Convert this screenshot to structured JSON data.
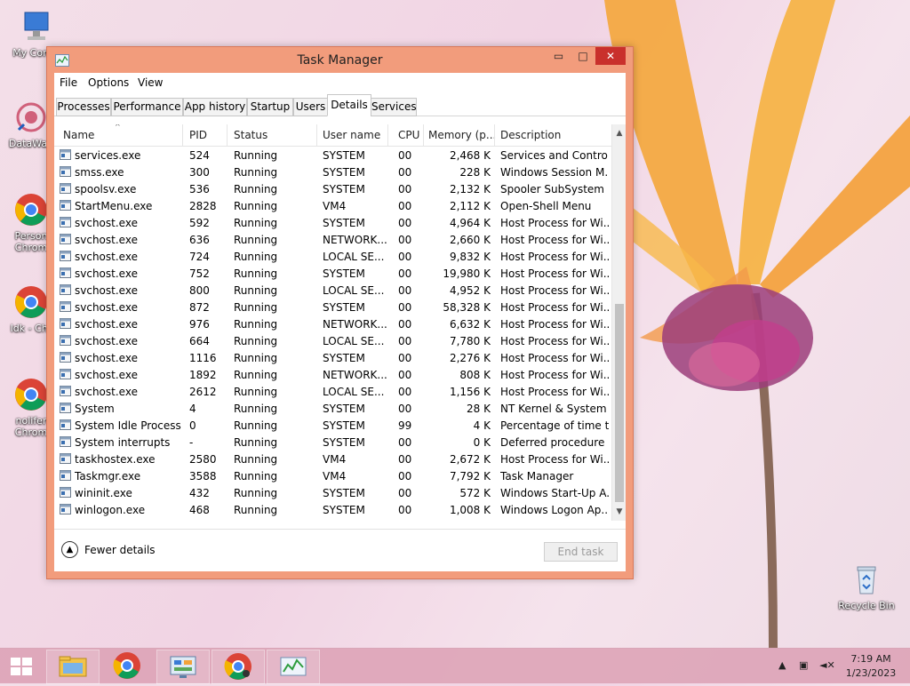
{
  "desktop": {
    "icons": [
      {
        "label": "My Comp",
        "glyph": "computer-icon"
      },
      {
        "label": "DataWag",
        "glyph": "app-icon"
      },
      {
        "label": "Person",
        "label2": "Chrom",
        "glyph": "chrome-icon"
      },
      {
        "label": "ldk - Chr",
        "glyph": "chrome-icon"
      },
      {
        "label": "nolifer",
        "label2": "Chrom",
        "glyph": "chrome-icon"
      },
      {
        "label": "Recycle Bin",
        "glyph": "recycle-bin-icon"
      }
    ]
  },
  "window": {
    "title": "Task Manager",
    "min_glyph": "▭",
    "max_glyph": "□",
    "close_glyph": "✕",
    "menu": [
      "File",
      "Options",
      "View"
    ],
    "tabs": [
      "Processes",
      "Performance",
      "App history",
      "Startup",
      "Users",
      "Details",
      "Services"
    ],
    "active_tab": "Details",
    "columns": [
      "Name",
      "PID",
      "Status",
      "User name",
      "CPU",
      "Memory (p...",
      "Description"
    ],
    "rows": [
      {
        "name": "services.exe",
        "pid": "524",
        "status": "Running",
        "user": "SYSTEM",
        "cpu": "00",
        "mem": "2,468 K",
        "desc": "Services and Control..."
      },
      {
        "name": "smss.exe",
        "pid": "300",
        "status": "Running",
        "user": "SYSTEM",
        "cpu": "00",
        "mem": "228 K",
        "desc": "Windows Session M..."
      },
      {
        "name": "spoolsv.exe",
        "pid": "536",
        "status": "Running",
        "user": "SYSTEM",
        "cpu": "00",
        "mem": "2,132 K",
        "desc": "Spooler SubSystem ..."
      },
      {
        "name": "StartMenu.exe",
        "pid": "2828",
        "status": "Running",
        "user": "VM4",
        "cpu": "00",
        "mem": "2,112 K",
        "desc": "Open-Shell Menu"
      },
      {
        "name": "svchost.exe",
        "pid": "592",
        "status": "Running",
        "user": "SYSTEM",
        "cpu": "00",
        "mem": "4,964 K",
        "desc": "Host Process for Wi..."
      },
      {
        "name": "svchost.exe",
        "pid": "636",
        "status": "Running",
        "user": "NETWORK...",
        "cpu": "00",
        "mem": "2,660 K",
        "desc": "Host Process for Wi..."
      },
      {
        "name": "svchost.exe",
        "pid": "724",
        "status": "Running",
        "user": "LOCAL SE...",
        "cpu": "00",
        "mem": "9,832 K",
        "desc": "Host Process for Wi..."
      },
      {
        "name": "svchost.exe",
        "pid": "752",
        "status": "Running",
        "user": "SYSTEM",
        "cpu": "00",
        "mem": "19,980 K",
        "desc": "Host Process for Wi..."
      },
      {
        "name": "svchost.exe",
        "pid": "800",
        "status": "Running",
        "user": "LOCAL SE...",
        "cpu": "00",
        "mem": "4,952 K",
        "desc": "Host Process for Wi..."
      },
      {
        "name": "svchost.exe",
        "pid": "872",
        "status": "Running",
        "user": "SYSTEM",
        "cpu": "00",
        "mem": "58,328 K",
        "desc": "Host Process for Wi..."
      },
      {
        "name": "svchost.exe",
        "pid": "976",
        "status": "Running",
        "user": "NETWORK...",
        "cpu": "00",
        "mem": "6,632 K",
        "desc": "Host Process for Wi..."
      },
      {
        "name": "svchost.exe",
        "pid": "664",
        "status": "Running",
        "user": "LOCAL SE...",
        "cpu": "00",
        "mem": "7,780 K",
        "desc": "Host Process for Wi..."
      },
      {
        "name": "svchost.exe",
        "pid": "1116",
        "status": "Running",
        "user": "SYSTEM",
        "cpu": "00",
        "mem": "2,276 K",
        "desc": "Host Process for Wi..."
      },
      {
        "name": "svchost.exe",
        "pid": "1892",
        "status": "Running",
        "user": "NETWORK...",
        "cpu": "00",
        "mem": "808 K",
        "desc": "Host Process for Wi..."
      },
      {
        "name": "svchost.exe",
        "pid": "2612",
        "status": "Running",
        "user": "LOCAL SE...",
        "cpu": "00",
        "mem": "1,156 K",
        "desc": "Host Process for Wi..."
      },
      {
        "name": "System",
        "pid": "4",
        "status": "Running",
        "user": "SYSTEM",
        "cpu": "00",
        "mem": "28 K",
        "desc": "NT Kernel & System"
      },
      {
        "name": "System Idle Process",
        "pid": "0",
        "status": "Running",
        "user": "SYSTEM",
        "cpu": "99",
        "mem": "4 K",
        "desc": "Percentage of time t..."
      },
      {
        "name": "System interrupts",
        "pid": "-",
        "status": "Running",
        "user": "SYSTEM",
        "cpu": "00",
        "mem": "0 K",
        "desc": "Deferred procedure ..."
      },
      {
        "name": "taskhostex.exe",
        "pid": "2580",
        "status": "Running",
        "user": "VM4",
        "cpu": "00",
        "mem": "2,672 K",
        "desc": "Host Process for Wi..."
      },
      {
        "name": "Taskmgr.exe",
        "pid": "3588",
        "status": "Running",
        "user": "VM4",
        "cpu": "00",
        "mem": "7,792 K",
        "desc": "Task Manager"
      },
      {
        "name": "wininit.exe",
        "pid": "432",
        "status": "Running",
        "user": "SYSTEM",
        "cpu": "00",
        "mem": "572 K",
        "desc": "Windows Start-Up A..."
      },
      {
        "name": "winlogon.exe",
        "pid": "468",
        "status": "Running",
        "user": "SYSTEM",
        "cpu": "00",
        "mem": "1,008 K",
        "desc": "Windows Logon Ap..."
      }
    ],
    "fewer_details": "Fewer details",
    "end_task": "End task"
  },
  "taskbar": {
    "items": [
      "file-explorer-icon",
      "chrome-icon",
      "control-panel-icon",
      "chrome-icon",
      "task-manager-icon"
    ],
    "time": "7:19 AM",
    "date": "1/23/2023"
  },
  "colors": {
    "window_frame": "#f29c7c",
    "close_button": "#c9302c",
    "taskbar": "#dca0b4"
  }
}
